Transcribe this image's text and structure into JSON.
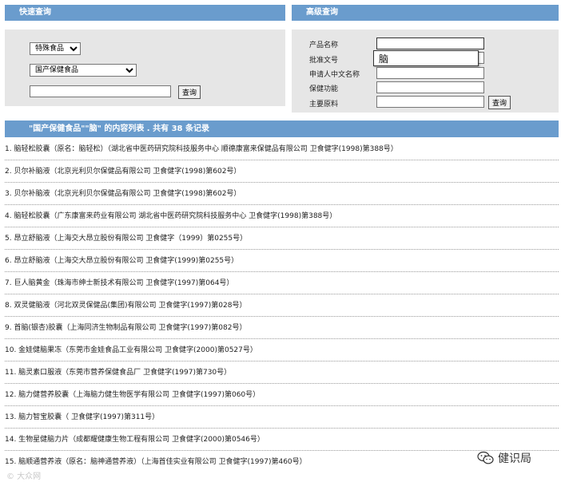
{
  "quick_search": {
    "title": "快速查询",
    "category_select": "特殊食品",
    "subcategory_select": "国产保健食品",
    "keyword_value": "",
    "search_button": "查询"
  },
  "advanced_search": {
    "title": "高级查询",
    "fields": [
      {
        "label": "产品名称",
        "value": ""
      },
      {
        "label": "批准文号",
        "value": ""
      },
      {
        "label": "申请人中文名称",
        "value": ""
      },
      {
        "label": "保健功能",
        "value": ""
      },
      {
        "label": "主要原料",
        "value": ""
      }
    ],
    "search_button": "查询",
    "autocomplete_suggestion": "脑"
  },
  "results": {
    "header": "\"国产保健食品\"\"脑\" 的内容列表 .  共有 38 条记录",
    "items": [
      "1. 脑轻松胶囊（原名：脑轻松）（湖北省中医药研究院科技服务中心  顺德康富来保健品有限公司  卫食健字(1998)第388号）",
      "2. 贝尔补脑液（北京光利贝尔保健品有限公司  卫食健字(1998)第602号）",
      "3. 贝尔补脑液（北京光利贝尔保健品有限公司  卫食健字(1998)第602号）",
      "4. 脑轻松胶囊（广东康富来药业有限公司  湖北省中医药研究院科技服务中心  卫食健字(1998)第388号）",
      "5. 昂立舒脑液（上海交大昂立股份有限公司  卫食健字（1999）第0255号）",
      "6. 昂立舒脑液（上海交大昂立股份有限公司  卫食健字(1999)第0255号）",
      "7. 巨人脑黄金（珠海市绅士新技术有限公司  卫食健字(1997)第064号）",
      "8. 双灵健脑液（河北双灵保健品(集团)有限公司  卫食健字(1997)第028号）",
      "9. 首脑(银杏)胶囊（上海同济生物制品有限公司  卫食健字(1997)第082号）",
      "10. 金娃健脑果冻（东莞市金娃食品工业有限公司  卫食健字(2000)第0527号）",
      "11. 脑灵素口服液（东莞市营养保健食品厂  卫食健字(1997)第730号）",
      "12. 脑力健营养胶囊（上海脑力健生物医学有限公司  卫食健字(1997)第060号）",
      "13. 脑力智宝胶囊（  卫食健字(1997)第311号）",
      "14. 生物星健脑力片（成都耀健康生物工程有限公司  卫食健字(2000)第0546号）",
      "15. 脑顺通营养液（原名：脑神通营养液）（上海首佳实业有限公司  卫食健字(1997)第460号）"
    ]
  },
  "watermarks": {
    "left": "© 大众网",
    "right": "健识局"
  }
}
